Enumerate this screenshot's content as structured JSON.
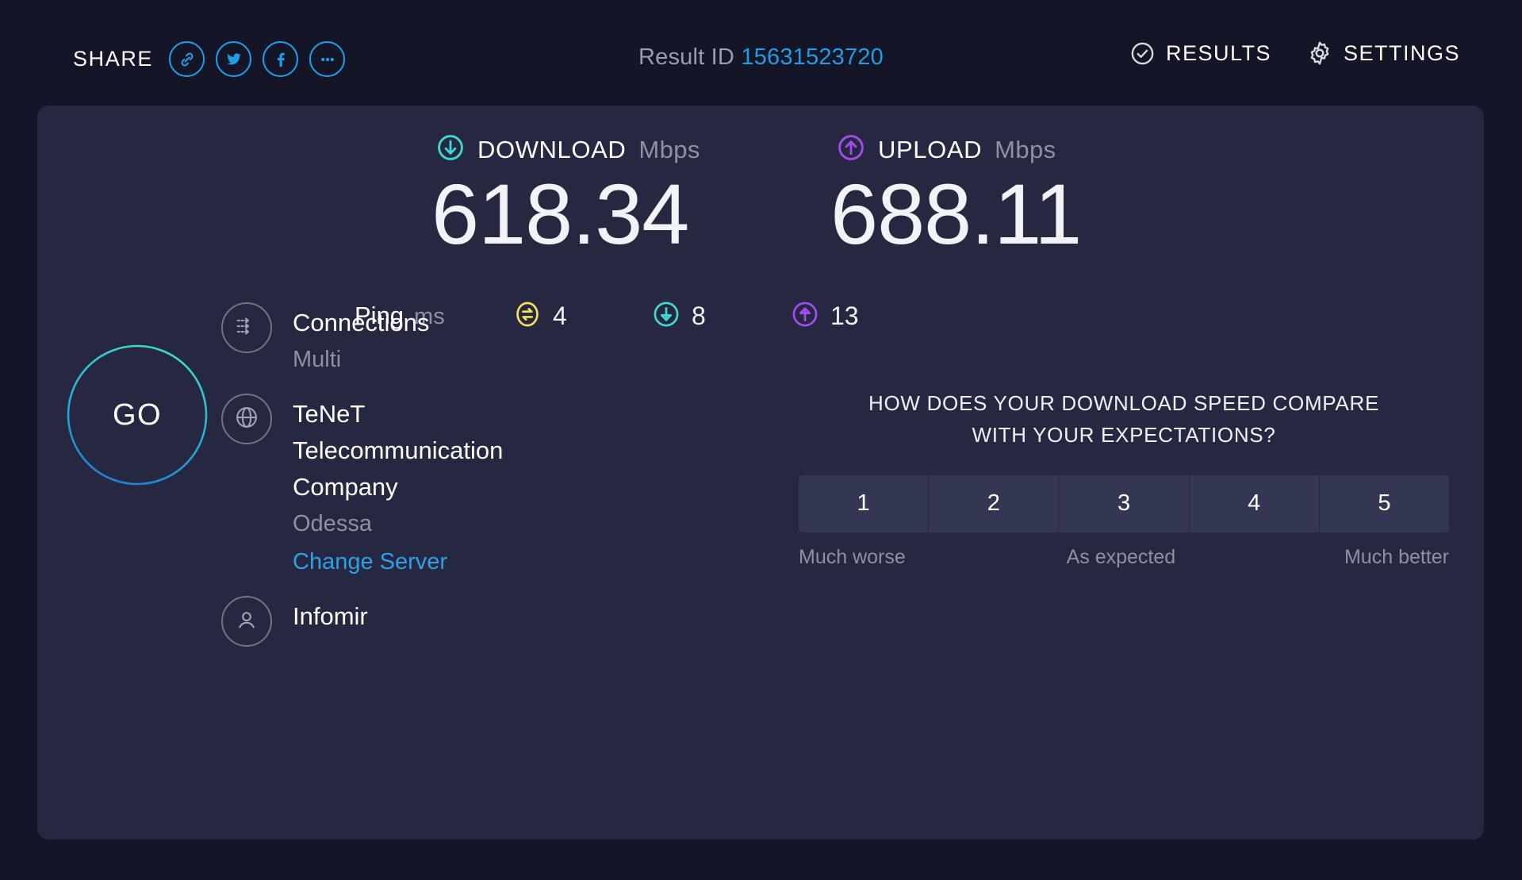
{
  "topbar": {
    "share_label": "SHARE",
    "share_buttons": [
      {
        "name": "link-icon",
        "title": "Copy link"
      },
      {
        "name": "twitter-icon",
        "title": "Twitter"
      },
      {
        "name": "facebook-icon",
        "title": "Facebook"
      },
      {
        "name": "more-icon",
        "title": "More"
      }
    ],
    "result_id_label": "Result ID",
    "result_id": "15631523720",
    "results_label": "RESULTS",
    "settings_label": "SETTINGS"
  },
  "download": {
    "title": "DOWNLOAD",
    "unit": "Mbps",
    "value": "618.34",
    "color": "#3fd8d4"
  },
  "upload": {
    "title": "UPLOAD",
    "unit": "Mbps",
    "value": "688.11",
    "color": "#a24cf0"
  },
  "ping": {
    "label": "Ping",
    "unit": "ms",
    "idle": {
      "value": "4",
      "color": "#f2e15c"
    },
    "download": {
      "value": "8",
      "color": "#3fd8d4"
    },
    "upload": {
      "value": "13",
      "color": "#a24cf0"
    }
  },
  "go_button": {
    "label": "GO",
    "color": "#2ec8d0"
  },
  "info": {
    "connections": {
      "label": "Connections",
      "value": "Multi"
    },
    "server": {
      "name": "TeNeT Telecommunication Company",
      "city": "Odessa",
      "change_link": "Change Server"
    },
    "isp": {
      "name": "Infomir"
    }
  },
  "survey": {
    "question_line1": "HOW DOES YOUR DOWNLOAD SPEED COMPARE",
    "question_line2": "WITH YOUR EXPECTATIONS?",
    "options": [
      "1",
      "2",
      "3",
      "4",
      "5"
    ],
    "label_low": "Much worse",
    "label_mid": "As expected",
    "label_high": "Much better"
  }
}
